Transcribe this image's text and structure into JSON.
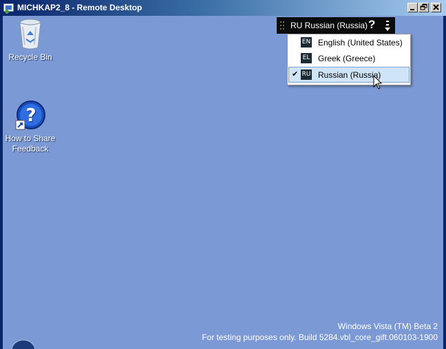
{
  "window": {
    "title": "MICHKAP2_8 - Remote Desktop",
    "controls": {
      "minimize": "minimize",
      "restore": "restore",
      "close": "close"
    }
  },
  "desktop": {
    "icons": [
      {
        "label": "Recycle Bin",
        "icon": "recycle-bin-icon"
      },
      {
        "label_line1": "How to Share",
        "label_line2": "Feedback",
        "icon": "help-shortcut-icon"
      }
    ],
    "watermark": {
      "line1": "Windows Vista (TM) Beta 2",
      "line2": "For testing purposes only. Build 5284.vbl_core_gift.060103-1900"
    },
    "background_color": "#7b99d4"
  },
  "language_bar": {
    "current": "RU Russian (Russia)",
    "help": "?"
  },
  "language_menu": {
    "items": [
      {
        "code": "EN",
        "label": "English (United States)",
        "checked": false
      },
      {
        "code": "EL",
        "label": "Greek (Greece)",
        "checked": false
      },
      {
        "code": "RU",
        "label": "Russian (Russia)",
        "checked": true
      }
    ],
    "check_mark": "✔"
  }
}
